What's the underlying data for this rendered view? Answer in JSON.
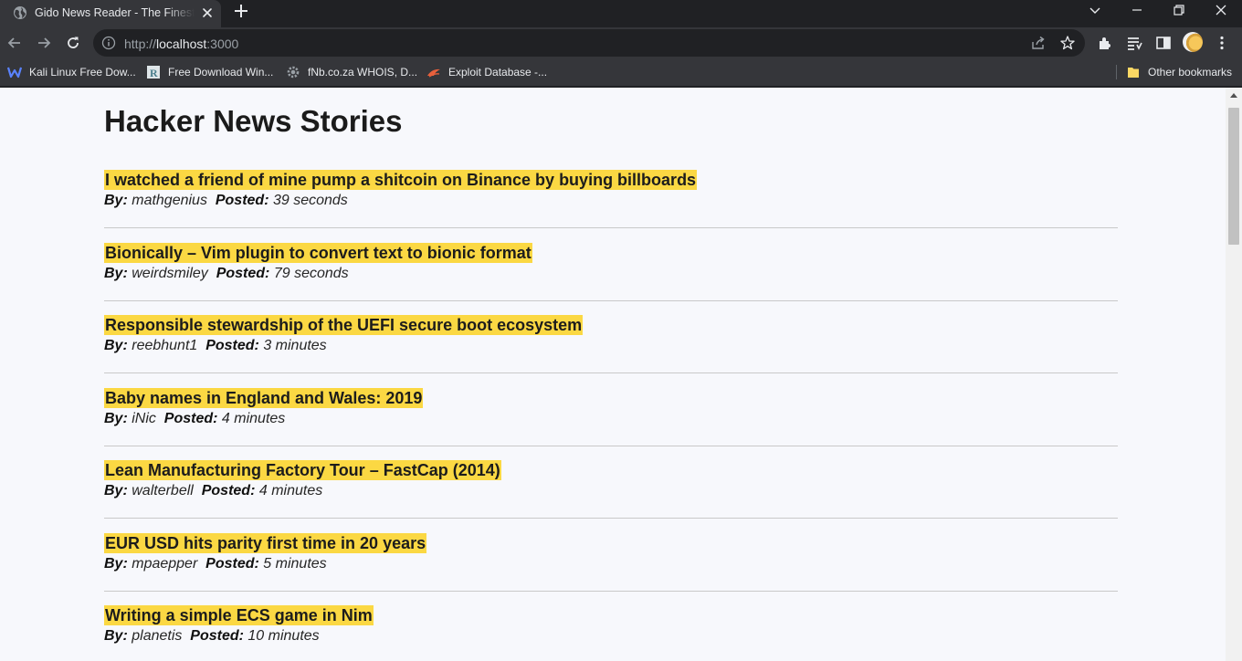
{
  "browser": {
    "tab": {
      "title": "Gido News Reader - The Finest News Reader",
      "favicon": "globe-icon"
    },
    "address_bar": {
      "scheme": "http://",
      "host": "localhost",
      "port": ":3000"
    },
    "bookmarks": [
      {
        "label": "Kali Linux Free Dow...",
        "icon": "kali-icon"
      },
      {
        "label": "Free Download Win...",
        "icon": "r-logo-icon"
      },
      {
        "label": "fNb.co.za WHOIS, D...",
        "icon": "gear-icon"
      },
      {
        "label": "Exploit Database -...",
        "icon": "exploit-db-icon"
      }
    ],
    "other_bookmarks": {
      "label": "Other bookmarks",
      "icon": "folder-icon"
    },
    "colors": {
      "frame": "#202124",
      "toolbar": "#35363a",
      "page_background": "#f7f8fc",
      "highlight": "#fbd843"
    }
  },
  "page": {
    "title": "Hacker News Stories",
    "by_label": "By:",
    "posted_label": "Posted:",
    "stories": [
      {
        "title": "I watched a friend of mine pump a shitcoin on Binance by buying billboards",
        "author": "mathgenius",
        "posted": "39 seconds"
      },
      {
        "title": "Bionically – Vim plugin to convert text to bionic format",
        "author": "weirdsmiley",
        "posted": "79 seconds"
      },
      {
        "title": "Responsible stewardship of the UEFI secure boot ecosystem",
        "author": "reebhunt1",
        "posted": "3 minutes"
      },
      {
        "title": "Baby names in England and Wales: 2019",
        "author": "iNic",
        "posted": "4 minutes"
      },
      {
        "title": "Lean Manufacturing Factory Tour – FastCap (2014)",
        "author": "walterbell",
        "posted": "4 minutes"
      },
      {
        "title": "EUR USD hits parity first time in 20 years",
        "author": "mpaepper",
        "posted": "5 minutes"
      },
      {
        "title": "Writing a simple ECS game in Nim",
        "author": "planetis",
        "posted": "10 minutes"
      }
    ]
  }
}
